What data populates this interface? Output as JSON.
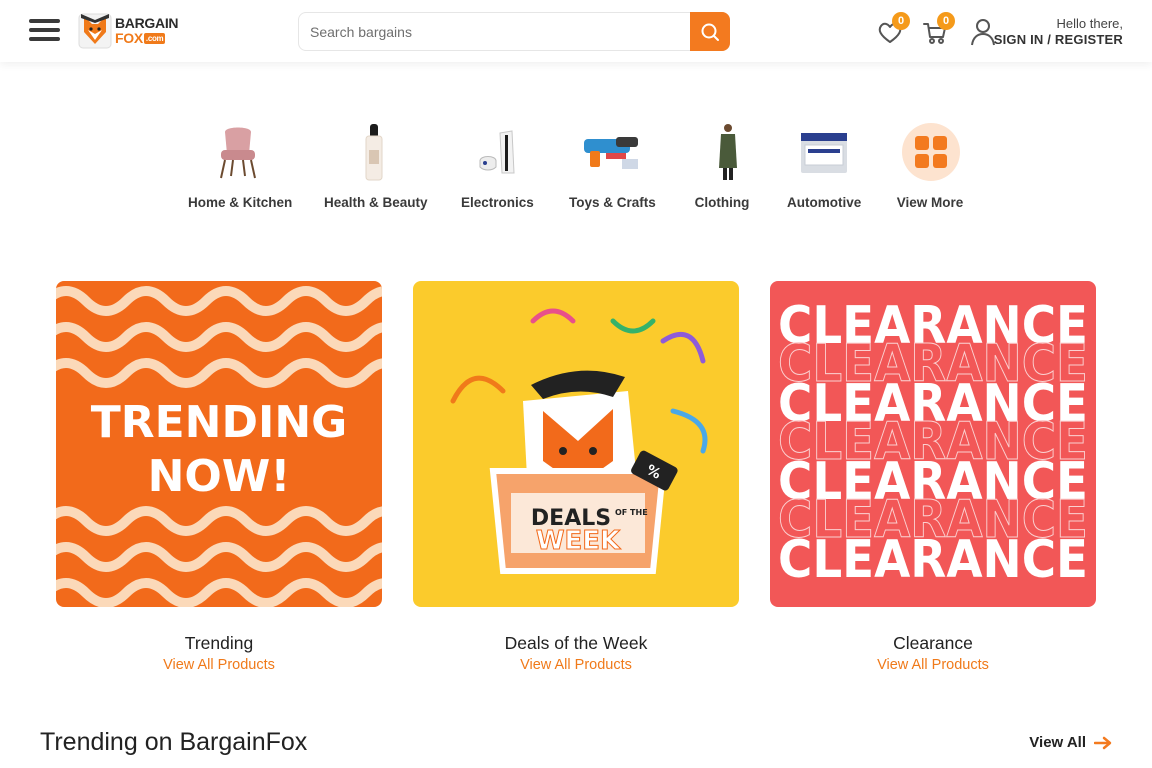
{
  "header": {
    "logo_line1": "BARGAIN",
    "logo_line2": "FOX",
    "logo_suffix": ".com",
    "search_placeholder": "Search bargains",
    "wishlist_count": "0",
    "cart_count": "0",
    "greeting": "Hello there,",
    "signin_label": "SIGN IN / REGISTER",
    "accent_color": "#f37a1f",
    "badge_color": "#f59a1a",
    "icons": [
      "hamburger-menu-icon",
      "search-icon",
      "heart-icon",
      "cart-icon",
      "user-icon"
    ]
  },
  "categories": [
    {
      "label": "Home & Kitchen",
      "icon": "armchair-icon"
    },
    {
      "label": "Health & Beauty",
      "icon": "serum-bottle-icon"
    },
    {
      "label": "Electronics",
      "icon": "game-console-icon"
    },
    {
      "label": "Toys & Crafts",
      "icon": "toy-blaster-icon"
    },
    {
      "label": "Clothing",
      "icon": "coat-model-icon"
    },
    {
      "label": "Automotive",
      "icon": "car-battery-icon"
    },
    {
      "label": "View More",
      "icon": "grid-icon"
    }
  ],
  "promos": [
    {
      "title": "Trending",
      "link": "View All Products",
      "image_line1": "TRENDING",
      "image_line2": "NOW!"
    },
    {
      "title": "Deals of the Week",
      "link": "View All Products",
      "image_line1": "DEALS",
      "image_line1_small": "OF THE",
      "image_line2": "WEEK",
      "tag": "%"
    },
    {
      "title": "Clearance",
      "link": "View All Products",
      "image_word": "CLEARANCE"
    }
  ],
  "section": {
    "title": "Trending on BargainFox",
    "view_all": "View All"
  }
}
